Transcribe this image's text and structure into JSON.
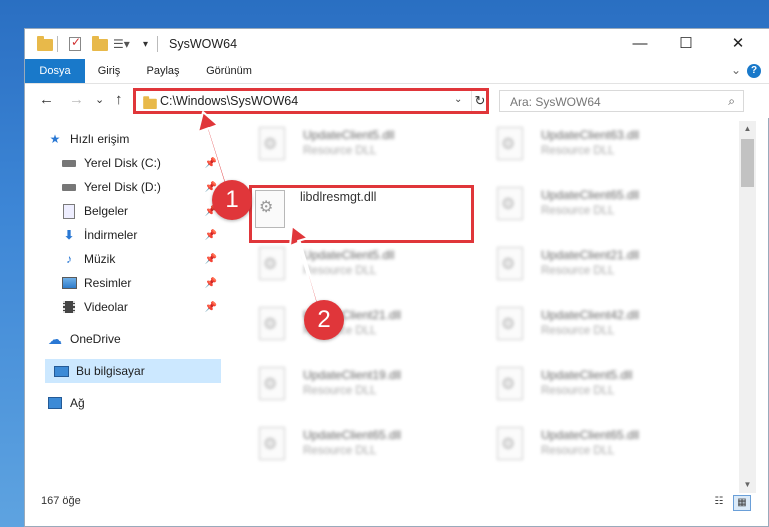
{
  "window": {
    "title": "SysWOW64"
  },
  "window_buttons": {
    "minimize": "—",
    "maximize": "☐",
    "close": "✕"
  },
  "ribbon": {
    "tabs": [
      "Dosya",
      "Giriş",
      "Paylaş",
      "Görünüm"
    ],
    "help": "?",
    "expand": "⌄"
  },
  "nav": {
    "back": "←",
    "forward": "→",
    "recent": "⌄",
    "up": "↑",
    "address": "C:\\Windows\\SysWOW64",
    "address_dropdown": "⌄",
    "refresh": "↻",
    "search_placeholder": "Ara: SysWOW64"
  },
  "sidebar": {
    "quick_access": "Hızlı erişim",
    "items": [
      {
        "label": "Yerel Disk (C:)",
        "icon": "drive-icon",
        "pinned": true
      },
      {
        "label": "Yerel Disk (D:)",
        "icon": "drive-icon",
        "pinned": true
      },
      {
        "label": "Belgeler",
        "icon": "documents-icon",
        "pinned": true
      },
      {
        "label": "İndirmeler",
        "icon": "downloads-icon",
        "pinned": true
      },
      {
        "label": "Müzik",
        "icon": "music-icon",
        "pinned": true
      },
      {
        "label": "Resimler",
        "icon": "pictures-icon",
        "pinned": true
      },
      {
        "label": "Videolar",
        "icon": "videos-icon",
        "pinned": true
      }
    ],
    "onedrive": "OneDrive",
    "this_pc": "Bu bilgisayar",
    "network": "Ağ"
  },
  "files": {
    "left_column": [
      {
        "name": "UpdateClient5.dll",
        "type": "Resource DLL"
      },
      {
        "name": "libdlresmgt.dll",
        "type": ""
      },
      {
        "name": "UpdateClient5.dll",
        "type": "Resource DLL"
      },
      {
        "name": "UpdateClient21.dll",
        "type": "Resource DLL"
      },
      {
        "name": "UpdateClient19.dll",
        "type": "Resource DLL"
      },
      {
        "name": "UpdateClient65.dll",
        "type": "Resource DLL"
      }
    ],
    "right_column": [
      {
        "name": "UpdateClient63.dll",
        "type": "Resource DLL"
      },
      {
        "name": "UpdateClient65.dll",
        "type": "Resource DLL"
      },
      {
        "name": "UpdateClient21.dll",
        "type": "Resource DLL"
      },
      {
        "name": "UpdateClient42.dll",
        "type": "Resource DLL"
      },
      {
        "name": "UpdateClient5.dll",
        "type": "Resource DLL"
      },
      {
        "name": "UpdateClient65.dll",
        "type": "Resource DLL"
      }
    ]
  },
  "status": {
    "count": "167 öğe",
    "details_view": "☷",
    "tiles_view": "▦"
  },
  "annotations": {
    "step1": "1",
    "step2": "2",
    "highlight_color": "#e0363a"
  }
}
